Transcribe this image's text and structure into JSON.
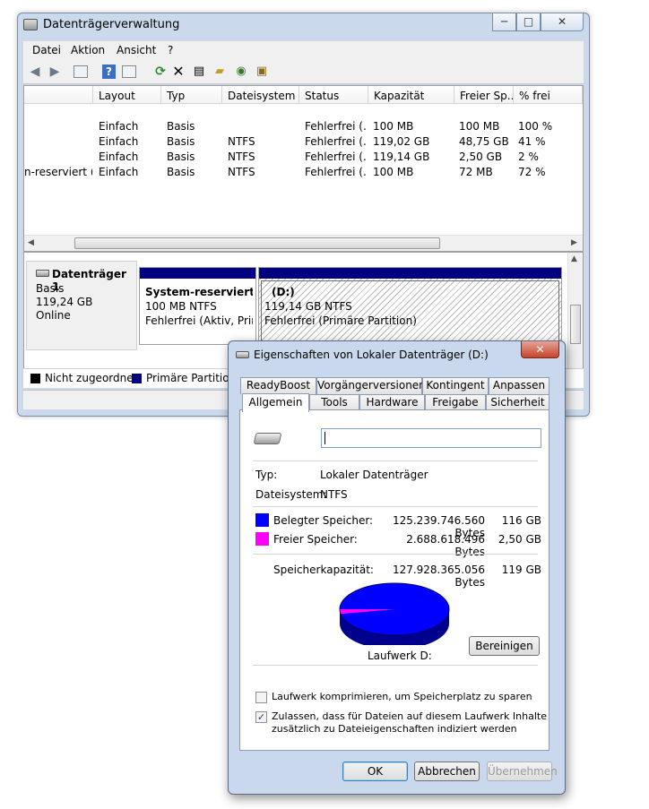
{
  "main_window": {
    "title": "Datenträgerverwaltung",
    "controls": {
      "minimize": "─",
      "maximize": "□",
      "close": "✕"
    },
    "menu": [
      "Datei",
      "Aktion",
      "Ansicht",
      "?"
    ],
    "columns": [
      "Layout",
      "Typ",
      "Dateisystem",
      "Status",
      "Kapazität",
      "Freier Sp...",
      "% frei"
    ],
    "rows": [
      [
        "",
        "Einfach",
        "Basis",
        "",
        "Fehlerfrei (...",
        "100 MB",
        "100 MB",
        "100 %"
      ],
      [
        "",
        "Einfach",
        "Basis",
        "NTFS",
        "Fehlerfrei (...",
        "119,02 GB",
        "48,75 GB",
        "41 %"
      ],
      [
        "",
        "Einfach",
        "Basis",
        "NTFS",
        "Fehlerfrei (...",
        "119,14 GB",
        "2,50 GB",
        "2 %"
      ],
      [
        "n-reserviert (...",
        "Einfach",
        "Basis",
        "NTFS",
        "Fehlerfrei (...",
        "100 MB",
        "72 MB",
        "72 %"
      ]
    ],
    "disk": {
      "name": "Datenträger 1",
      "type": "Basis",
      "size": "119,24 GB",
      "state": "Online"
    },
    "partitions": [
      {
        "title": "System-reserviert  (E",
        "line1": "100 MB NTFS",
        "line2": "Fehlerfrei (Aktiv, Primä"
      },
      {
        "title": "(D:)",
        "line1": "119,14 GB NTFS",
        "line2": "Fehlerfrei (Primäre Partition)"
      }
    ],
    "legend": [
      {
        "label": "Nicht zugeordnet",
        "color": "#000000"
      },
      {
        "label": "Primäre Partition",
        "color": "#000080"
      }
    ]
  },
  "dialog": {
    "title": "Eigenschaften von Lokaler Datenträger (D:)",
    "tabs_back": [
      "ReadyBoost",
      "Vorgängerversionen",
      "Kontingent",
      "Anpassen"
    ],
    "tabs_front": [
      "Allgemein",
      "Tools",
      "Hardware",
      "Freigabe",
      "Sicherheit"
    ],
    "active_tab": "Allgemein",
    "name_value": "",
    "typ_label": "Typ:",
    "typ_value": "Lokaler Datenträger",
    "fs_label": "Dateisystem:",
    "fs_value": "NTFS",
    "used_label": "Belegter Speicher:",
    "used_bytes": "125.239.746.560 Bytes",
    "used_gb": "116 GB",
    "used_color": "#0000ff",
    "free_label": "Freier Speicher:",
    "free_bytes": "2.688.618.496 Bytes",
    "free_gb": "2,50 GB",
    "free_color": "#ff00ff",
    "cap_label": "Speicherkapazität:",
    "cap_bytes": "127.928.365.056 Bytes",
    "cap_gb": "119 GB",
    "drive_label": "Laufwerk D:",
    "cleanup_button": "Bereinigen",
    "compress_label": "Laufwerk komprimieren, um Speicherplatz zu sparen",
    "compress_checked": false,
    "index_label_1": "Zulassen, dass für Dateien auf diesem Laufwerk Inhalte",
    "index_label_2": "zusätzlich zu Dateieigenschaften indiziert werden",
    "index_checked": true,
    "ok": "OK",
    "cancel": "Abbrechen",
    "apply": "Übernehmen"
  }
}
